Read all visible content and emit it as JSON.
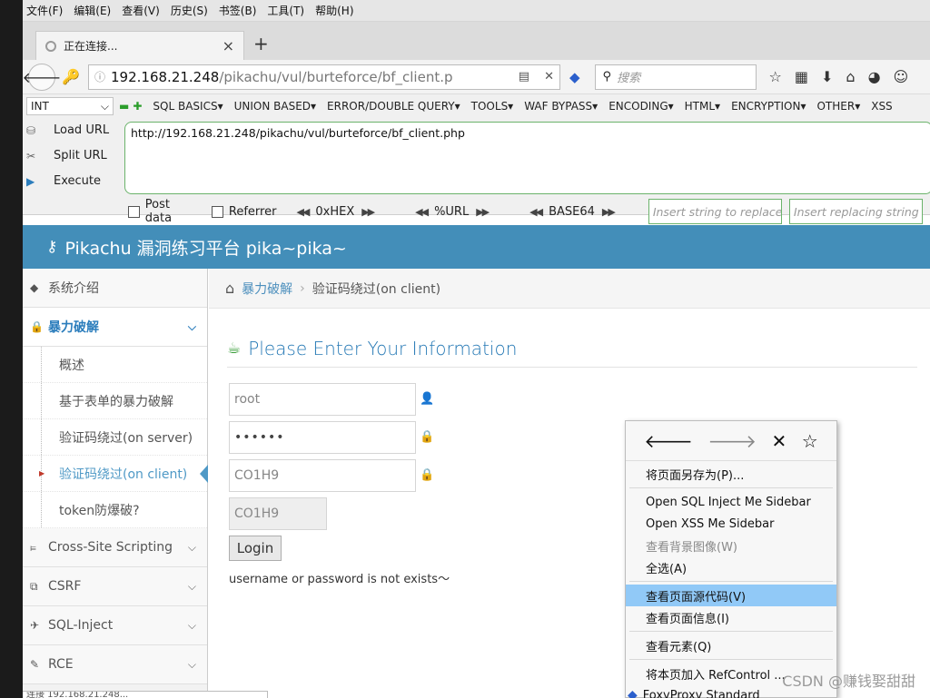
{
  "menubar": [
    "文件(F)",
    "编辑(E)",
    "查看(V)",
    "历史(S)",
    "书签(B)",
    "工具(T)",
    "帮助(H)"
  ],
  "tab": {
    "title": "正在连接...",
    "close": "×",
    "new_tab": "+"
  },
  "nav": {
    "url_host": "192.168.21.248",
    "url_path": "/pikachu/vul/burteforce/bf_client.p",
    "search_placeholder": "搜索"
  },
  "hackbar": {
    "select_value": "INT",
    "menus": [
      "SQL BASICS▾",
      "UNION BASED▾",
      "ERROR/DOUBLE QUERY▾",
      "TOOLS▾",
      "WAF BYPASS▾",
      "ENCODING▾",
      "HTML▾",
      "ENCRYPTION▾",
      "OTHER▾",
      "XSS"
    ],
    "load_url": "Load URL",
    "split_url": "Split URL",
    "execute": "Execute",
    "textarea": "http://192.168.21.248/pikachu/vul/burteforce/bf_client.php",
    "post_data": "Post data",
    "referrer": "Referrer",
    "hex": "0xHEX",
    "url_enc": "%URL",
    "base64": "BASE64",
    "replace_placeholder": "Insert string to replace",
    "replacing_placeholder": "Insert replacing string"
  },
  "pikachu": {
    "header": "Pikachu 漏洞练习平台 pika~pika~",
    "sidebar": {
      "intro": "系统介绍",
      "brute": "暴力破解",
      "subs": [
        "概述",
        "基于表单的暴力破解",
        "验证码绕过(on server)",
        "验证码绕过(on client)",
        "token防爆破?"
      ],
      "xss": "Cross-Site Scripting",
      "csrf": "CSRF",
      "sqli": "SQL-Inject",
      "rce": "RCE"
    },
    "breadcrumb": {
      "level1": "暴力破解",
      "level2": "验证码绕过(on client)"
    },
    "page_title": "Please Enter Your Information",
    "username": "root",
    "password": "••••••",
    "captcha_input": "CO1H9",
    "captcha_code": "CO1H9",
    "login": "Login",
    "message": "username or password is not exists～"
  },
  "context_menu": {
    "items": [
      {
        "label": "将页面另存为(P)...",
        "disabled": false
      },
      {
        "label": "Open SQL Inject Me Sidebar",
        "disabled": false
      },
      {
        "label": "Open XSS Me Sidebar",
        "disabled": false
      },
      {
        "label": "查看背景图像(W)",
        "disabled": true
      },
      {
        "label": "全选(A)",
        "disabled": false
      },
      {
        "label": "查看页面源代码(V)",
        "disabled": false
      },
      {
        "label": "查看页面信息(I)",
        "disabled": false
      },
      {
        "label": "查看元素(Q)",
        "disabled": false
      },
      {
        "label": "将本页加入 RefControl ...",
        "disabled": false
      },
      {
        "label": "FoxyProxy Standard",
        "disabled": false
      }
    ]
  },
  "status": "连接 192.168.21.248...",
  "watermark": "CSDN @赚钱娶甜甜",
  "colors": {
    "header_blue": "#438eb9",
    "menu_highlight": "#91c9f7",
    "hackbar_green": "#6bb36b"
  }
}
